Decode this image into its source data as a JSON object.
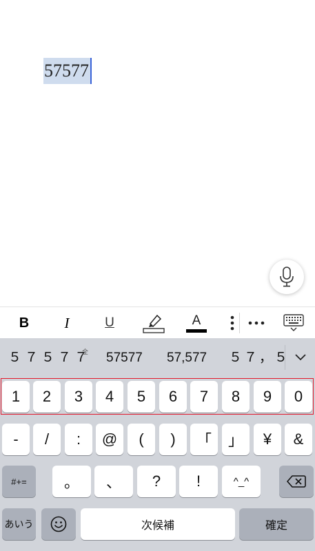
{
  "document": {
    "text": "57577"
  },
  "toolbar": {
    "bold": "B",
    "italic": "I",
    "underline": "U",
    "font_color_letter": "A",
    "font_color": "#000000"
  },
  "keyboard": {
    "candidates": [
      "５７５７７",
      "57577",
      "57,577",
      "５７，５"
    ],
    "candidate_badge": "全",
    "number_row": [
      "1",
      "2",
      "3",
      "4",
      "5",
      "6",
      "7",
      "8",
      "9",
      "0"
    ],
    "symbol_row": [
      "-",
      "/",
      ":",
      "@",
      "(",
      ")",
      "「",
      "」",
      "¥",
      "&"
    ],
    "punct_row": {
      "shift_symbols": "#+=",
      "keys": [
        "。",
        "、",
        "?",
        "!",
        "^_^"
      ]
    },
    "bottom_row": {
      "kana": "あいう",
      "space": "次候補",
      "kakutei": "確定"
    }
  },
  "colors": {
    "selection": "#cfdcee",
    "caret": "#3a63d8",
    "highlight_outline": "#e3182b",
    "keyboard_bg": "#d1d4da"
  }
}
